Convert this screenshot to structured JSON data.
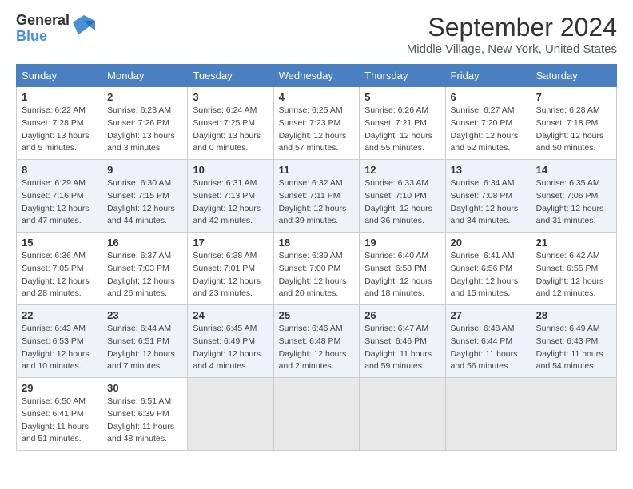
{
  "logo": {
    "text_general": "General",
    "text_blue": "Blue"
  },
  "title": "September 2024",
  "subtitle": "Middle Village, New York, United States",
  "header": {
    "days": [
      "Sunday",
      "Monday",
      "Tuesday",
      "Wednesday",
      "Thursday",
      "Friday",
      "Saturday"
    ]
  },
  "weeks": [
    [
      {
        "day": "1",
        "sunrise": "Sunrise: 6:22 AM",
        "sunset": "Sunset: 7:28 PM",
        "daylight": "Daylight: 13 hours and 5 minutes."
      },
      {
        "day": "2",
        "sunrise": "Sunrise: 6:23 AM",
        "sunset": "Sunset: 7:26 PM",
        "daylight": "Daylight: 13 hours and 3 minutes."
      },
      {
        "day": "3",
        "sunrise": "Sunrise: 6:24 AM",
        "sunset": "Sunset: 7:25 PM",
        "daylight": "Daylight: 13 hours and 0 minutes."
      },
      {
        "day": "4",
        "sunrise": "Sunrise: 6:25 AM",
        "sunset": "Sunset: 7:23 PM",
        "daylight": "Daylight: 12 hours and 57 minutes."
      },
      {
        "day": "5",
        "sunrise": "Sunrise: 6:26 AM",
        "sunset": "Sunset: 7:21 PM",
        "daylight": "Daylight: 12 hours and 55 minutes."
      },
      {
        "day": "6",
        "sunrise": "Sunrise: 6:27 AM",
        "sunset": "Sunset: 7:20 PM",
        "daylight": "Daylight: 12 hours and 52 minutes."
      },
      {
        "day": "7",
        "sunrise": "Sunrise: 6:28 AM",
        "sunset": "Sunset: 7:18 PM",
        "daylight": "Daylight: 12 hours and 50 minutes."
      }
    ],
    [
      {
        "day": "8",
        "sunrise": "Sunrise: 6:29 AM",
        "sunset": "Sunset: 7:16 PM",
        "daylight": "Daylight: 12 hours and 47 minutes."
      },
      {
        "day": "9",
        "sunrise": "Sunrise: 6:30 AM",
        "sunset": "Sunset: 7:15 PM",
        "daylight": "Daylight: 12 hours and 44 minutes."
      },
      {
        "day": "10",
        "sunrise": "Sunrise: 6:31 AM",
        "sunset": "Sunset: 7:13 PM",
        "daylight": "Daylight: 12 hours and 42 minutes."
      },
      {
        "day": "11",
        "sunrise": "Sunrise: 6:32 AM",
        "sunset": "Sunset: 7:11 PM",
        "daylight": "Daylight: 12 hours and 39 minutes."
      },
      {
        "day": "12",
        "sunrise": "Sunrise: 6:33 AM",
        "sunset": "Sunset: 7:10 PM",
        "daylight": "Daylight: 12 hours and 36 minutes."
      },
      {
        "day": "13",
        "sunrise": "Sunrise: 6:34 AM",
        "sunset": "Sunset: 7:08 PM",
        "daylight": "Daylight: 12 hours and 34 minutes."
      },
      {
        "day": "14",
        "sunrise": "Sunrise: 6:35 AM",
        "sunset": "Sunset: 7:06 PM",
        "daylight": "Daylight: 12 hours and 31 minutes."
      }
    ],
    [
      {
        "day": "15",
        "sunrise": "Sunrise: 6:36 AM",
        "sunset": "Sunset: 7:05 PM",
        "daylight": "Daylight: 12 hours and 28 minutes."
      },
      {
        "day": "16",
        "sunrise": "Sunrise: 6:37 AM",
        "sunset": "Sunset: 7:03 PM",
        "daylight": "Daylight: 12 hours and 26 minutes."
      },
      {
        "day": "17",
        "sunrise": "Sunrise: 6:38 AM",
        "sunset": "Sunset: 7:01 PM",
        "daylight": "Daylight: 12 hours and 23 minutes."
      },
      {
        "day": "18",
        "sunrise": "Sunrise: 6:39 AM",
        "sunset": "Sunset: 7:00 PM",
        "daylight": "Daylight: 12 hours and 20 minutes."
      },
      {
        "day": "19",
        "sunrise": "Sunrise: 6:40 AM",
        "sunset": "Sunset: 6:58 PM",
        "daylight": "Daylight: 12 hours and 18 minutes."
      },
      {
        "day": "20",
        "sunrise": "Sunrise: 6:41 AM",
        "sunset": "Sunset: 6:56 PM",
        "daylight": "Daylight: 12 hours and 15 minutes."
      },
      {
        "day": "21",
        "sunrise": "Sunrise: 6:42 AM",
        "sunset": "Sunset: 6:55 PM",
        "daylight": "Daylight: 12 hours and 12 minutes."
      }
    ],
    [
      {
        "day": "22",
        "sunrise": "Sunrise: 6:43 AM",
        "sunset": "Sunset: 6:53 PM",
        "daylight": "Daylight: 12 hours and 10 minutes."
      },
      {
        "day": "23",
        "sunrise": "Sunrise: 6:44 AM",
        "sunset": "Sunset: 6:51 PM",
        "daylight": "Daylight: 12 hours and 7 minutes."
      },
      {
        "day": "24",
        "sunrise": "Sunrise: 6:45 AM",
        "sunset": "Sunset: 6:49 PM",
        "daylight": "Daylight: 12 hours and 4 minutes."
      },
      {
        "day": "25",
        "sunrise": "Sunrise: 6:46 AM",
        "sunset": "Sunset: 6:48 PM",
        "daylight": "Daylight: 12 hours and 2 minutes."
      },
      {
        "day": "26",
        "sunrise": "Sunrise: 6:47 AM",
        "sunset": "Sunset: 6:46 PM",
        "daylight": "Daylight: 11 hours and 59 minutes."
      },
      {
        "day": "27",
        "sunrise": "Sunrise: 6:48 AM",
        "sunset": "Sunset: 6:44 PM",
        "daylight": "Daylight: 11 hours and 56 minutes."
      },
      {
        "day": "28",
        "sunrise": "Sunrise: 6:49 AM",
        "sunset": "Sunset: 6:43 PM",
        "daylight": "Daylight: 11 hours and 54 minutes."
      }
    ],
    [
      {
        "day": "29",
        "sunrise": "Sunrise: 6:50 AM",
        "sunset": "Sunset: 6:41 PM",
        "daylight": "Daylight: 11 hours and 51 minutes."
      },
      {
        "day": "30",
        "sunrise": "Sunrise: 6:51 AM",
        "sunset": "Sunset: 6:39 PM",
        "daylight": "Daylight: 11 hours and 48 minutes."
      },
      null,
      null,
      null,
      null,
      null
    ]
  ]
}
